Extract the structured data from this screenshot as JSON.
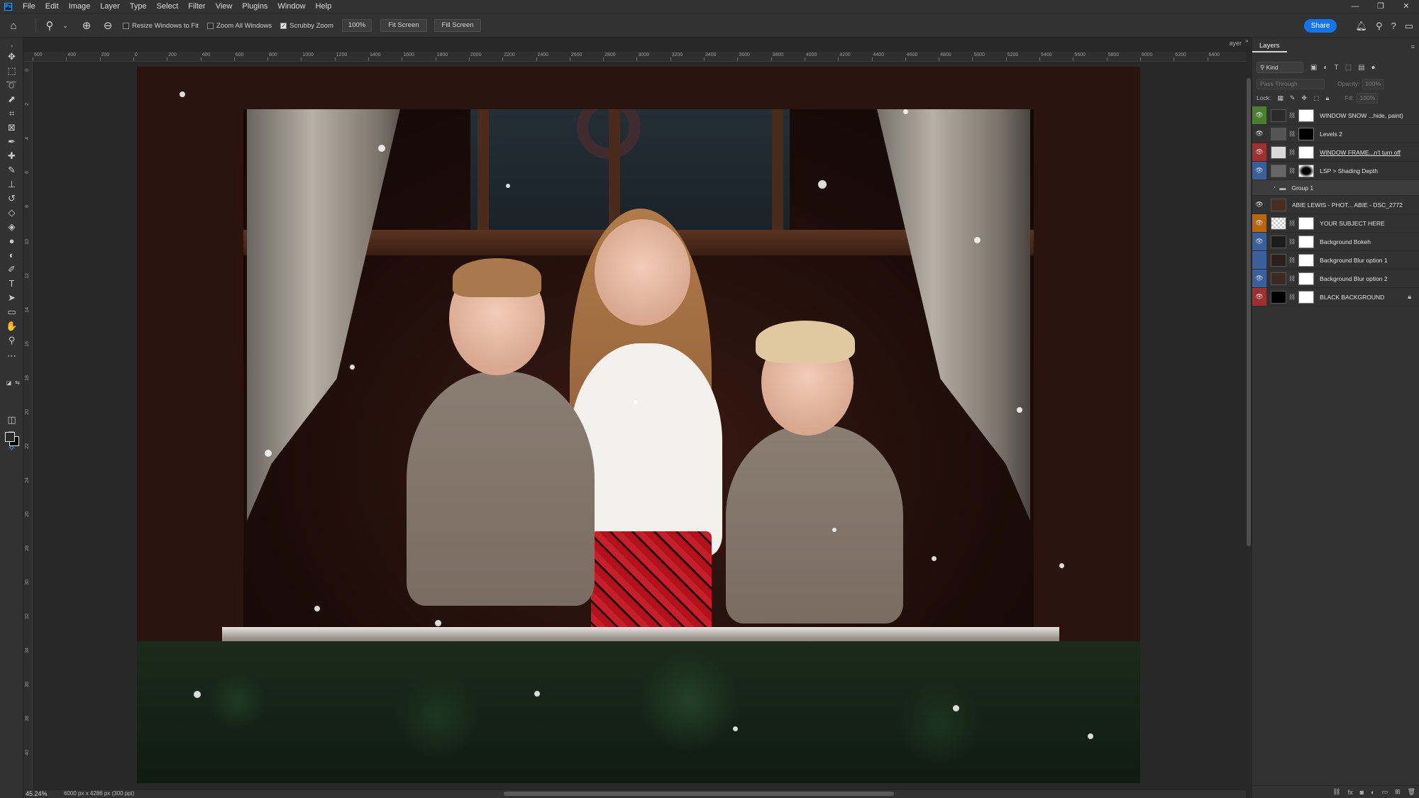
{
  "app": {
    "logo": "Ps"
  },
  "menu": [
    "File",
    "Edit",
    "Image",
    "Layer",
    "Type",
    "Select",
    "Filter",
    "View",
    "Plugins",
    "Window",
    "Help"
  ],
  "window_controls": [
    "—",
    "❐",
    "✕"
  ],
  "options": {
    "resize_windows": {
      "label": "Resize Windows to Fit",
      "checked": false
    },
    "zoom_all": {
      "label": "Zoom All Windows",
      "checked": false
    },
    "scrubby_zoom": {
      "label": "Scrubby Zoom",
      "checked": true
    },
    "zoom_value": "100%",
    "fit_screen": "Fit Screen",
    "fill_screen": "Fill Screen",
    "share": "Share"
  },
  "doc_tab_label": "ayer",
  "ruler_top": [
    "600",
    "400",
    "200",
    "0",
    "200",
    "400",
    "600",
    "800",
    "1000",
    "1200",
    "1400",
    "1600",
    "1800",
    "2000",
    "2200",
    "2400",
    "2600",
    "2800",
    "3000",
    "3200",
    "3400",
    "3600",
    "3800",
    "4000",
    "4200",
    "4400",
    "4600",
    "4800",
    "5000",
    "5200",
    "5400",
    "5600",
    "5800",
    "6000",
    "6200",
    "6400"
  ],
  "ruler_left": [
    "0",
    "2",
    "4",
    "6",
    "8",
    "10",
    "12",
    "14",
    "16",
    "18",
    "20",
    "22",
    "24",
    "26",
    "28",
    "30",
    "32",
    "34",
    "36",
    "38",
    "40"
  ],
  "status": {
    "zoom": "45.24%",
    "doc_info": "6000 px x 4286 px (300 ppi)"
  },
  "layers_panel": {
    "tab": "Layers",
    "kind": "Kind",
    "blend_mode": "Pass Through",
    "opacity_label": "Opacity:",
    "opacity_value": "100%",
    "lock_label": "Lock:",
    "fill_label": "Fill:",
    "fill_value": "100%",
    "layers": [
      {
        "name": "WINDOW SNOW ...hide, paint)",
        "tag": "#4a7f2f",
        "visible": true
      },
      {
        "name": "Levels 2",
        "tag": "",
        "visible": true
      },
      {
        "name": "WINDOW FRAME...n't turn off",
        "tag": "#a03030",
        "visible": true
      },
      {
        "name": "LSP > Shading Depth",
        "tag": "#3a5f9a",
        "visible": true
      },
      {
        "name": "Group 1",
        "tag": "",
        "visible": false
      },
      {
        "name": "ABIE LEWIS - PHOT... ABIE - DSC_2772",
        "tag": "",
        "visible": true
      },
      {
        "name": "YOUR SUBJECT HERE",
        "tag": "#b8670f",
        "visible": true
      },
      {
        "name": "Background Bokeh",
        "tag": "#3a5f9a",
        "visible": true
      },
      {
        "name": "Background Blur option 1",
        "tag": "#3a5f9a",
        "visible": false
      },
      {
        "name": "Background Blur option 2",
        "tag": "#3a5f9a",
        "visible": true
      },
      {
        "name": "BLACK BACKGROUND",
        "tag": "#a03030",
        "visible": true
      }
    ]
  }
}
